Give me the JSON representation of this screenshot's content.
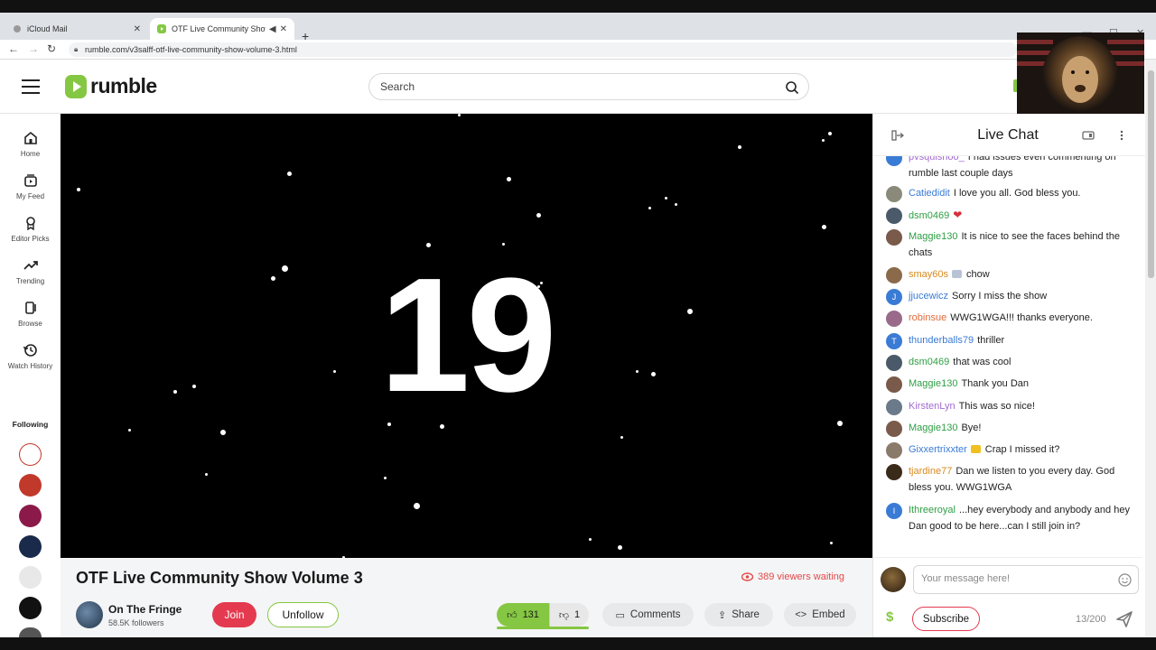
{
  "browser": {
    "tabs": [
      {
        "label": "iCloud Mail"
      },
      {
        "label": "OTF Live Community Show"
      }
    ],
    "url": "rumble.com/v3salff-otf-live-community-show-volume-3.html"
  },
  "header": {
    "logo_text": "rumble",
    "search_placeholder": "Search"
  },
  "sidebar": {
    "items": [
      {
        "label": "Home",
        "icon": "home-icon"
      },
      {
        "label": "My Feed",
        "icon": "feed-icon"
      },
      {
        "label": "Editor Picks",
        "icon": "award-icon"
      },
      {
        "label": "Trending",
        "icon": "trending-icon"
      },
      {
        "label": "Browse",
        "icon": "browse-icon"
      },
      {
        "label": "Watch History",
        "icon": "history-icon"
      }
    ],
    "following_label": "Following",
    "following_colors": [
      "#ffffff",
      "#c0392b",
      "#8b1a4a",
      "#1a2a4a",
      "#e8e8e8",
      "#111111",
      "#555555"
    ]
  },
  "video": {
    "countdown": "19"
  },
  "info": {
    "title": "OTF Live Community Show Volume 3",
    "viewers": "389 viewers waiting",
    "channel_name": "On The Fringe",
    "followers": "58.5K followers",
    "join_label": "Join",
    "unfollow_label": "Unfollow",
    "upvotes": "131",
    "downvotes": "1",
    "comments_label": "Comments",
    "share_label": "Share",
    "embed_label": "Embed",
    "accent_color": "#85c742",
    "red_color": "#e43a4f"
  },
  "chat": {
    "title": "Live Chat",
    "messages": [
      {
        "user": "pvsquishoo_",
        "text": "I had issues even commenting on rumble last couple days",
        "color": "#a36bd1",
        "avatar": "#3a7bd5"
      },
      {
        "user": "Catiedidit",
        "text": "I love you all. God bless you.",
        "color": "#3a7bd5",
        "avatar": "#8a8a7a"
      },
      {
        "user": "dsm0469",
        "text": "",
        "color": "#2e9e44",
        "avatar": "#4a5a6a",
        "emote": "heart"
      },
      {
        "user": "Maggie130",
        "text": "It is nice to see the faces behind the chats",
        "color": "#2e9e44",
        "avatar": "#7a5a4a"
      },
      {
        "user": "smay60s",
        "text": "chow",
        "color": "#d98a1e",
        "avatar": "#8a6a4a",
        "badge": true
      },
      {
        "user": "jjucewicz",
        "text": "Sorry I miss the show",
        "color": "#3a7bd5",
        "avatar": "#3a7bd5",
        "letter": "J"
      },
      {
        "user": "robinsue",
        "text": "WWG1WGA!!! thanks everyone.",
        "color": "#e06a3a",
        "avatar": "#9a6a8a"
      },
      {
        "user": "thunderballs79",
        "text": "thriller",
        "color": "#3a7bd5",
        "avatar": "#3a7bd5",
        "letter": "T"
      },
      {
        "user": "dsm0469",
        "text": "that was cool",
        "color": "#2e9e44",
        "avatar": "#4a5a6a"
      },
      {
        "user": "Maggie130",
        "text": "Thank you Dan",
        "color": "#2e9e44",
        "avatar": "#7a5a4a"
      },
      {
        "user": "KirstenLyn",
        "text": "This was so nice!",
        "color": "#a36bd1",
        "avatar": "#6a7a8a"
      },
      {
        "user": "Maggie130",
        "text": "Bye!",
        "color": "#2e9e44",
        "avatar": "#7a5a4a"
      },
      {
        "user": "Gixxertrixxter",
        "text": "Crap I missed it?",
        "color": "#3a7bd5",
        "avatar": "#8a7a6a",
        "badge": true
      },
      {
        "user": "tjardine77",
        "text": "Dan we listen to you every day. God bless you. WWG1WGA",
        "color": "#d98a1e",
        "avatar": "#3a2a1a"
      },
      {
        "user": "Ithreeroyal",
        "text": "...hey everybody and anybody and hey Dan good to be here...can I still join in?",
        "color": "#2e9e44",
        "avatar": "#3a7bd5",
        "letter": "I"
      }
    ],
    "input_placeholder": "Your message here!",
    "subscribe_label": "Subscribe",
    "char_count": "13/200",
    "dollar": "$"
  }
}
